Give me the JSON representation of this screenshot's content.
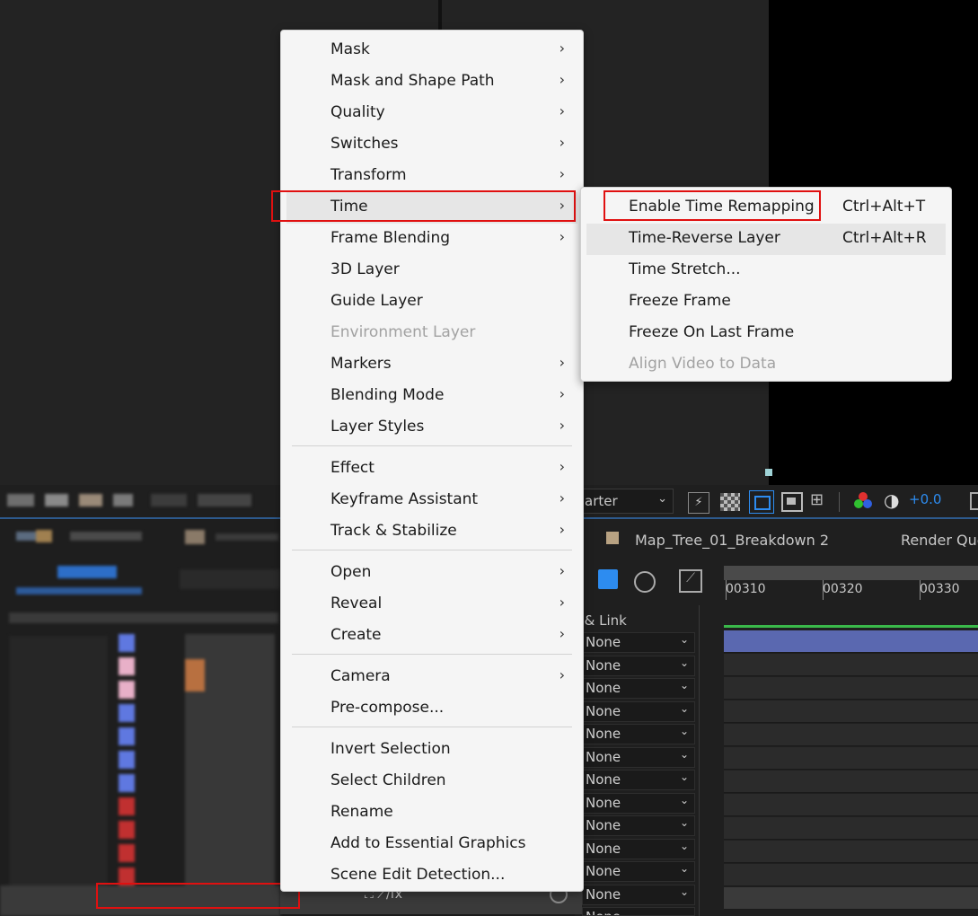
{
  "context_menu": {
    "items": [
      {
        "label": "Mask",
        "submenu": true
      },
      {
        "label": "Mask and Shape Path",
        "submenu": true
      },
      {
        "label": "Quality",
        "submenu": true
      },
      {
        "label": "Switches",
        "submenu": true
      },
      {
        "label": "Transform",
        "submenu": true
      },
      {
        "label": "Time",
        "submenu": true,
        "highlighted": true
      },
      {
        "label": "Frame Blending",
        "submenu": true
      },
      {
        "label": "3D Layer",
        "submenu": false
      },
      {
        "label": "Guide Layer",
        "submenu": false
      },
      {
        "label": "Environment Layer",
        "submenu": false,
        "disabled": true
      },
      {
        "label": "Markers",
        "submenu": true
      },
      {
        "label": "Blending Mode",
        "submenu": true
      },
      {
        "label": "Layer Styles",
        "submenu": true
      },
      {
        "label": "Effect",
        "submenu": true
      },
      {
        "label": "Keyframe Assistant",
        "submenu": true
      },
      {
        "label": "Track & Stabilize",
        "submenu": true
      },
      {
        "label": "Open",
        "submenu": true
      },
      {
        "label": "Reveal",
        "submenu": true
      },
      {
        "label": "Create",
        "submenu": true
      },
      {
        "label": "Camera",
        "submenu": true
      },
      {
        "label": "Pre-compose...",
        "submenu": false
      },
      {
        "label": "Invert Selection",
        "submenu": false
      },
      {
        "label": "Select Children",
        "submenu": false
      },
      {
        "label": "Rename",
        "submenu": false
      },
      {
        "label": "Add to Essential Graphics",
        "submenu": false
      },
      {
        "label": "Scene Edit Detection...",
        "submenu": false
      }
    ],
    "arrow_glyph": "›"
  },
  "time_submenu": {
    "items": [
      {
        "label": "Enable Time Remapping",
        "shortcut": "Ctrl+Alt+T"
      },
      {
        "label": "Time-Reverse Layer",
        "shortcut": "Ctrl+Alt+R",
        "highlighted": true
      },
      {
        "label": "Time Stretch...",
        "shortcut": ""
      },
      {
        "label": "Freeze Frame",
        "shortcut": ""
      },
      {
        "label": "Freeze On Last Frame",
        "shortcut": ""
      },
      {
        "label": "Align Video to Data",
        "shortcut": "",
        "disabled": true
      }
    ]
  },
  "viewer_toolbar": {
    "resolution_value": "arter",
    "exposure_value": "+0.0"
  },
  "timeline": {
    "comp_tab": "Map_Tree_01_Breakdown 2",
    "render_queue_tab": "Render Que",
    "parent_link_header": "t & Link",
    "ruler_labels": [
      "00310",
      "00320",
      "00330"
    ],
    "parent_values": [
      "None",
      "None",
      "None",
      "None",
      "None",
      "None",
      "None",
      "None",
      "None",
      "None",
      "None",
      "None",
      "None"
    ]
  },
  "colors": {
    "menu_bg": "#f5f5f5",
    "highlight_box": "#e01010",
    "accent_blue": "#2d8cf0"
  }
}
